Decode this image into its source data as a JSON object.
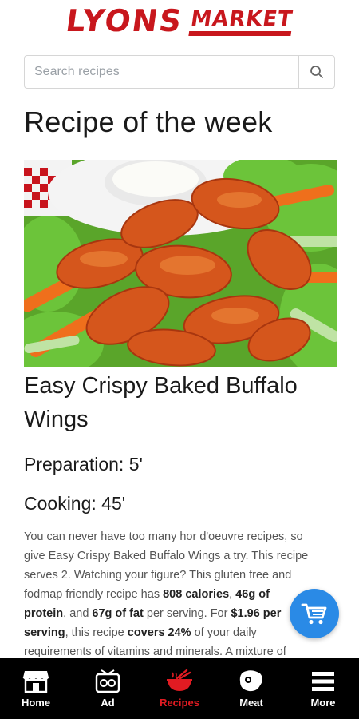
{
  "header": {
    "logo_word1": "LYONS",
    "logo_word2": "MARKET",
    "brand_color": "#c8171d"
  },
  "search": {
    "placeholder": "Search recipes",
    "icon": "search-icon"
  },
  "section_title": "Recipe of the week",
  "recipe": {
    "image_icon": "buffalo-wings-photo",
    "title": "Easy Crispy Baked Buffalo Wings",
    "preparation": "Preparation: 5'",
    "cooking": "Cooking: 45'",
    "description": {
      "t1": "You can never have too many hor d'oeuvre recipes, so give Easy Crispy Baked Buffalo Wings a try. This recipe serves 2. Watching your figure? This gluten free and fodmap friendly recipe has ",
      "b1": "808 calories",
      "t2": ", ",
      "b2": "46g of protein",
      "t3": ", and ",
      "b3": "67g of fat",
      "t4": " per serving. For ",
      "b4": "$1.96 per serving",
      "t5": ", this recipe ",
      "b5": "covers 24%",
      "t6": " of your daily requirements of vitamins and minerals. A mixture of"
    }
  },
  "cart_button": {
    "icon": "cart-icon",
    "color": "#2a8ae6"
  },
  "navbar": {
    "active_color": "#e11b22",
    "items": [
      {
        "label": "Home",
        "icon": "store-icon"
      },
      {
        "label": "Ad",
        "icon": "ad-icon"
      },
      {
        "label": "Recipes",
        "icon": "recipes-icon"
      },
      {
        "label": "Meat",
        "icon": "meat-icon"
      },
      {
        "label": "More",
        "icon": "menu-icon"
      }
    ]
  }
}
